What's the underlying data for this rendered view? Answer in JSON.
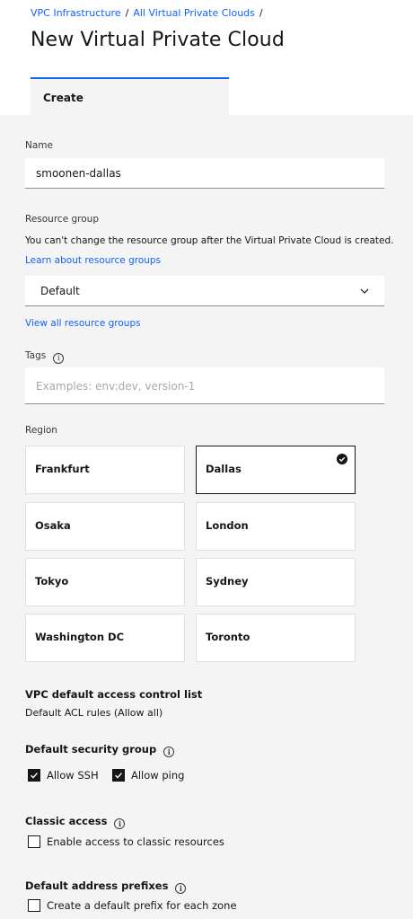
{
  "breadcrumb": {
    "items": [
      "VPC Infrastructure",
      "All Virtual Private Clouds"
    ],
    "separator": "/"
  },
  "page_title": "New Virtual Private Cloud",
  "tab": {
    "label": "Create"
  },
  "name": {
    "label": "Name",
    "value": "smoonen-dallas"
  },
  "resource_group": {
    "label": "Resource group",
    "note": "You can't change the resource group after the Virtual Private Cloud is created.",
    "learn_link": "Learn about resource groups",
    "selected": "Default",
    "view_all_link": "View all resource groups"
  },
  "tags": {
    "label": "Tags",
    "placeholder": "Examples: env:dev, version-1",
    "info_icon": "i"
  },
  "region": {
    "label": "Region",
    "options": [
      "Frankfurt",
      "Dallas",
      "Osaka",
      "London",
      "Tokyo",
      "Sydney",
      "Washington DC",
      "Toronto"
    ],
    "selected": "Dallas"
  },
  "acl": {
    "title": "VPC default access control list",
    "value": "Default ACL rules (Allow all)"
  },
  "security_group": {
    "title": "Default security group",
    "allow_ssh": {
      "label": "Allow SSH",
      "checked": true
    },
    "allow_ping": {
      "label": "Allow ping",
      "checked": true
    }
  },
  "classic_access": {
    "title": "Classic access",
    "option": {
      "label": "Enable access to classic resources",
      "checked": false
    }
  },
  "address_prefixes": {
    "title": "Default address prefixes",
    "option": {
      "label": "Create a default prefix for each zone",
      "checked": false
    }
  },
  "colors": {
    "link": "#0f62fe",
    "background": "#f4f4f4",
    "text": "#161616"
  }
}
